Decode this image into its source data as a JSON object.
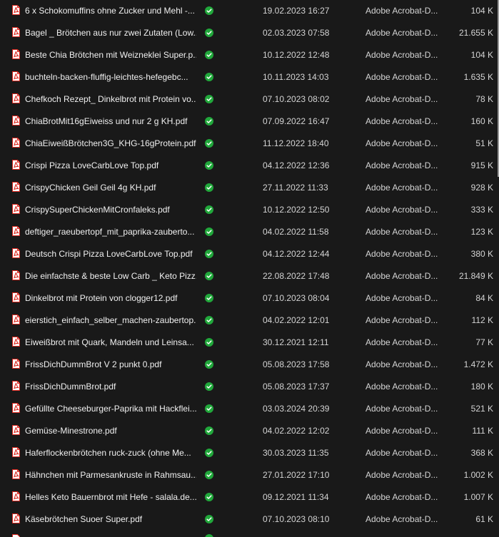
{
  "files": [
    {
      "name": "6 x Schokomuffins ohne Zucker und Mehl -...",
      "date": "19.02.2023 16:27",
      "type": "Adobe Acrobat-D...",
      "size": "104 K"
    },
    {
      "name": "Bagel _ Brötchen aus nur zwei Zutaten (Low...",
      "date": "02.03.2023 07:58",
      "type": "Adobe Acrobat-D...",
      "size": "21.655 K"
    },
    {
      "name": "Beste Chia Brötchen mit Weizneklei Super.p...",
      "date": "10.12.2022 12:48",
      "type": "Adobe Acrobat-D...",
      "size": "104 K"
    },
    {
      "name": "buchteln-backen-fluffig-leichtes-hefegebc...",
      "date": "10.11.2023 14:03",
      "type": "Adobe Acrobat-D...",
      "size": "1.635 K"
    },
    {
      "name": "Chefkoch Rezept_ Dinkelbrot mit Protein vo...",
      "date": "07.10.2023 08:02",
      "type": "Adobe Acrobat-D...",
      "size": "78 K"
    },
    {
      "name": "ChiaBrotMit16gEiweiss und nur 2 g KH.pdf",
      "date": "07.09.2022 16:47",
      "type": "Adobe Acrobat-D...",
      "size": "160 K"
    },
    {
      "name": "ChiaEiweißBrötchen3G_KHG-16gProtein.pdf",
      "date": "11.12.2022 18:40",
      "type": "Adobe Acrobat-D...",
      "size": "51 K"
    },
    {
      "name": "Crispi Pizza LoveCarbLove Top.pdf",
      "date": "04.12.2022 12:36",
      "type": "Adobe Acrobat-D...",
      "size": "915 K"
    },
    {
      "name": "CrispyChicken Geil Geil 4g KH.pdf",
      "date": "27.11.2022 11:33",
      "type": "Adobe Acrobat-D...",
      "size": "928 K"
    },
    {
      "name": "CrispySuperChickenMitCronfaleks.pdf",
      "date": "10.12.2022 12:50",
      "type": "Adobe Acrobat-D...",
      "size": "333 K"
    },
    {
      "name": "deftiger_raeubertopf_mit_paprika-zauberto...",
      "date": "04.02.2022 11:58",
      "type": "Adobe Acrobat-D...",
      "size": "123 K"
    },
    {
      "name": "Deutsch Crispi Pizza LoveCarbLove Top.pdf",
      "date": "04.12.2022 12:44",
      "type": "Adobe Acrobat-D...",
      "size": "380 K"
    },
    {
      "name": "Die einfachste & beste Low Carb _ Keto Pizz...",
      "date": "22.08.2022 17:48",
      "type": "Adobe Acrobat-D...",
      "size": "21.849 K"
    },
    {
      "name": "Dinkelbrot mit Protein von clogger12.pdf",
      "date": "07.10.2023 08:04",
      "type": "Adobe Acrobat-D...",
      "size": "84 K"
    },
    {
      "name": "eierstich_einfach_selber_machen-zaubertop...",
      "date": "04.02.2022 12:01",
      "type": "Adobe Acrobat-D...",
      "size": "112 K"
    },
    {
      "name": "Eiweißbrot mit Quark, Mandeln und Leinsa...",
      "date": "30.12.2021 12:11",
      "type": "Adobe Acrobat-D...",
      "size": "77 K"
    },
    {
      "name": "FrissDichDummBrot V 2 punkt 0.pdf",
      "date": "05.08.2023 17:58",
      "type": "Adobe Acrobat-D...",
      "size": "1.472 K"
    },
    {
      "name": "FrissDichDummBrot.pdf",
      "date": "05.08.2023 17:37",
      "type": "Adobe Acrobat-D...",
      "size": "180 K"
    },
    {
      "name": "Gefüllte Cheeseburger-Paprika mit Hackflei...",
      "date": "03.03.2024 20:39",
      "type": "Adobe Acrobat-D...",
      "size": "521 K"
    },
    {
      "name": "Gemüse-Minestrone.pdf",
      "date": "04.02.2022 12:02",
      "type": "Adobe Acrobat-D...",
      "size": "111 K"
    },
    {
      "name": "Haferflockenbrötchen ruck-zuck (ohne Me...",
      "date": "30.03.2023 11:35",
      "type": "Adobe Acrobat-D...",
      "size": "368 K"
    },
    {
      "name": "Hähnchen mit Parmesankruste in Rahmsau...",
      "date": "27.01.2022 17:10",
      "type": "Adobe Acrobat-D...",
      "size": "1.002 K"
    },
    {
      "name": "Helles Keto Bauernbrot mit Hefe - salala.de....",
      "date": "09.12.2021 11:34",
      "type": "Adobe Acrobat-D...",
      "size": "1.007 K"
    },
    {
      "name": "Käsebrötchen Suoer Super.pdf",
      "date": "07.10.2023 08:10",
      "type": "Adobe Acrobat-D...",
      "size": "61 K"
    }
  ],
  "icons": {
    "file_icon": "pdf-file-icon",
    "status_icon": "sync-ok-checkmark-icon"
  },
  "colors": {
    "background": "#191919",
    "pdf_red": "#d9251c",
    "status_green": "#21a83b",
    "text": "#e8e8e8"
  }
}
